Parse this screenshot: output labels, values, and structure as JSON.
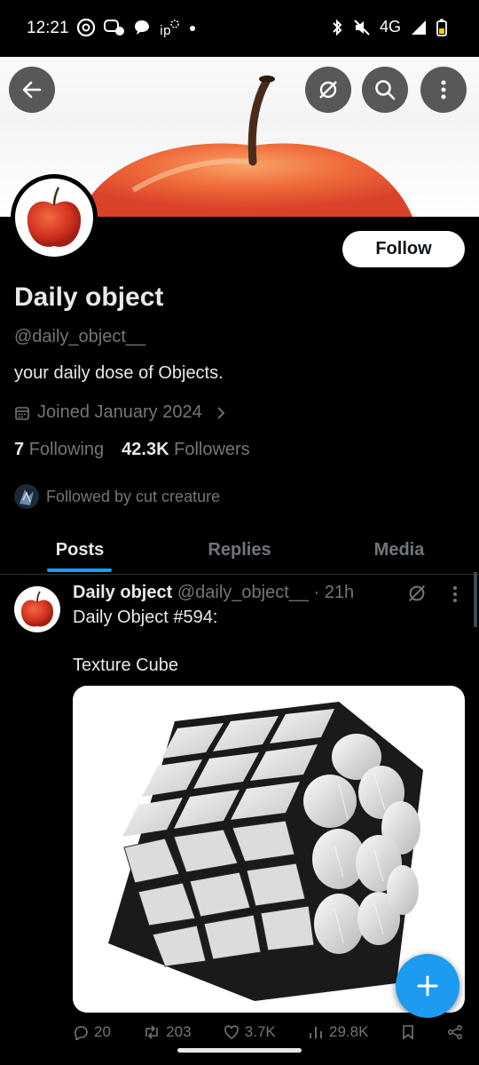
{
  "status_bar": {
    "time": "12:21",
    "network": "4G",
    "icons": [
      "threads-icon",
      "messenger-icon",
      "chat-icon",
      "ip-icon",
      "dot-icon",
      "bluetooth-icon",
      "mute-icon",
      "signal-icon",
      "battery-icon"
    ]
  },
  "header": {
    "back_icon": "back-arrow-icon",
    "grok_icon": "grok-icon",
    "search_icon": "search-icon",
    "more_icon": "more-vertical-icon"
  },
  "profile": {
    "display_name": "Daily object",
    "handle": "@daily_object__",
    "bio": "your daily dose of Objects.",
    "joined": "Joined January 2024",
    "following_count": "7",
    "following_label": "Following",
    "followers_count": "42.3K",
    "followers_label": "Followers",
    "followed_by": "Followed by cut creature",
    "follow_button": "Follow"
  },
  "tabs": [
    {
      "label": "Posts",
      "active": true
    },
    {
      "label": "Replies",
      "active": false
    },
    {
      "label": "Media",
      "active": false
    }
  ],
  "post": {
    "author_name": "Daily object",
    "author_handle": "@daily_object__",
    "separator": "·",
    "time": "21h",
    "text_line1": "Daily Object #594:",
    "text_line2": "Texture Cube",
    "replies": "20",
    "reposts": "203",
    "likes": "3.7K",
    "views": "29.8K"
  },
  "colors": {
    "accent": "#1d9bf0",
    "text_primary": "#e7e9ea",
    "text_secondary": "#71767b",
    "background": "#000000"
  }
}
